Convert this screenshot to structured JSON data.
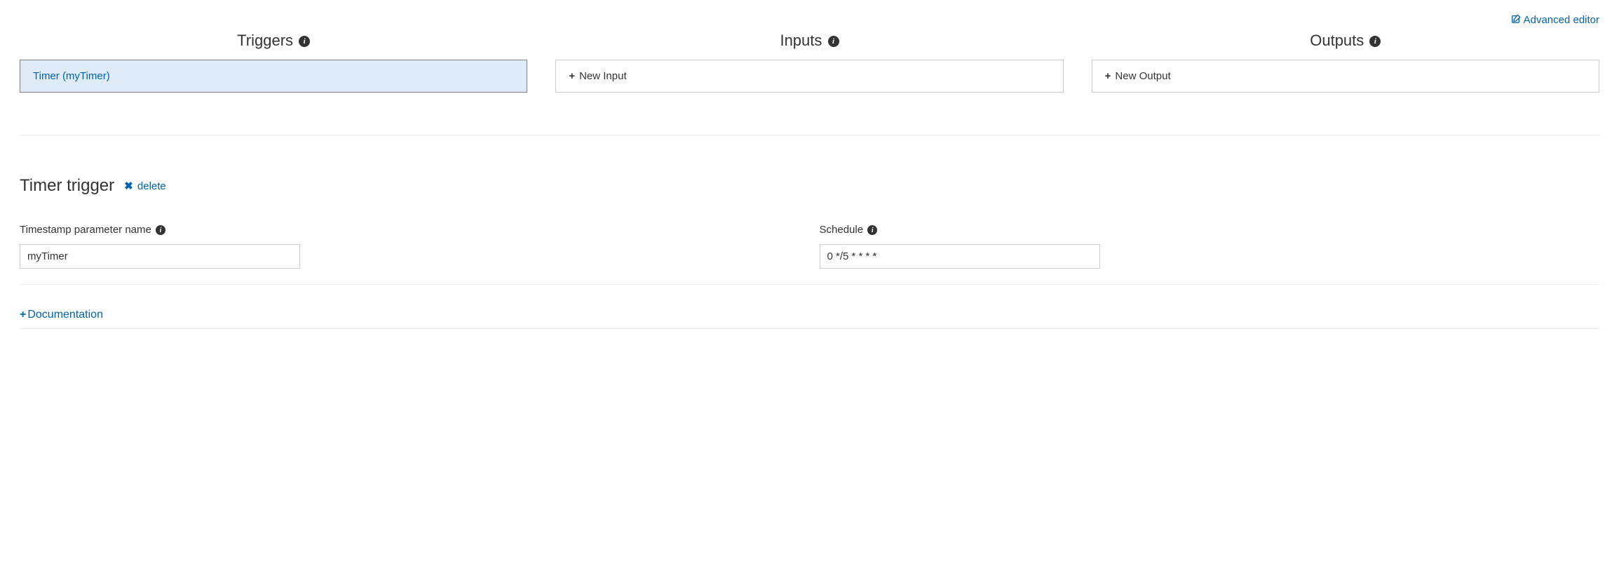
{
  "topLink": {
    "label": "Advanced editor"
  },
  "columns": {
    "triggers": {
      "header": "Triggers",
      "item": "Timer (myTimer)"
    },
    "inputs": {
      "header": "Inputs",
      "newLabel": "New Input"
    },
    "outputs": {
      "header": "Outputs",
      "newLabel": "New Output"
    }
  },
  "details": {
    "title": "Timer trigger",
    "deleteLabel": "delete",
    "timestampLabel": "Timestamp parameter name",
    "timestampValue": "myTimer",
    "scheduleLabel": "Schedule",
    "scheduleValue": "0 */5 * * * *"
  },
  "documentation": {
    "label": "Documentation"
  }
}
